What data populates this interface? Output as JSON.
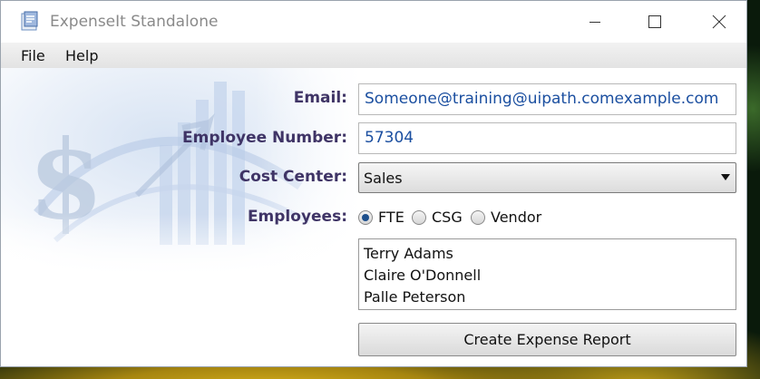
{
  "window": {
    "title": "ExpenseIt Standalone",
    "controls": {
      "minimize": "minimize-icon",
      "maximize": "maximize-icon",
      "close": "close-icon"
    }
  },
  "menu": {
    "items": [
      {
        "label": "File"
      },
      {
        "label": "Help"
      }
    ]
  },
  "form": {
    "email": {
      "label": "Email:",
      "value": "Someone@training@uipath.comexample.com"
    },
    "employee_number": {
      "label": "Employee Number:",
      "value": "57304"
    },
    "cost_center": {
      "label": "Cost Center:",
      "selected": "Sales"
    },
    "employees": {
      "label": "Employees:",
      "options": [
        {
          "label": "FTE",
          "checked": true
        },
        {
          "label": "CSG",
          "checked": false
        },
        {
          "label": "Vendor",
          "checked": false
        }
      ],
      "list": [
        "Terry Adams",
        "Claire O'Donnell",
        "Palle Peterson"
      ]
    },
    "submit_label": "Create Expense Report"
  },
  "colors": {
    "label_text": "#3f3466",
    "input_text": "#1b4fa0",
    "radio_dot": "#1d4f8c"
  }
}
